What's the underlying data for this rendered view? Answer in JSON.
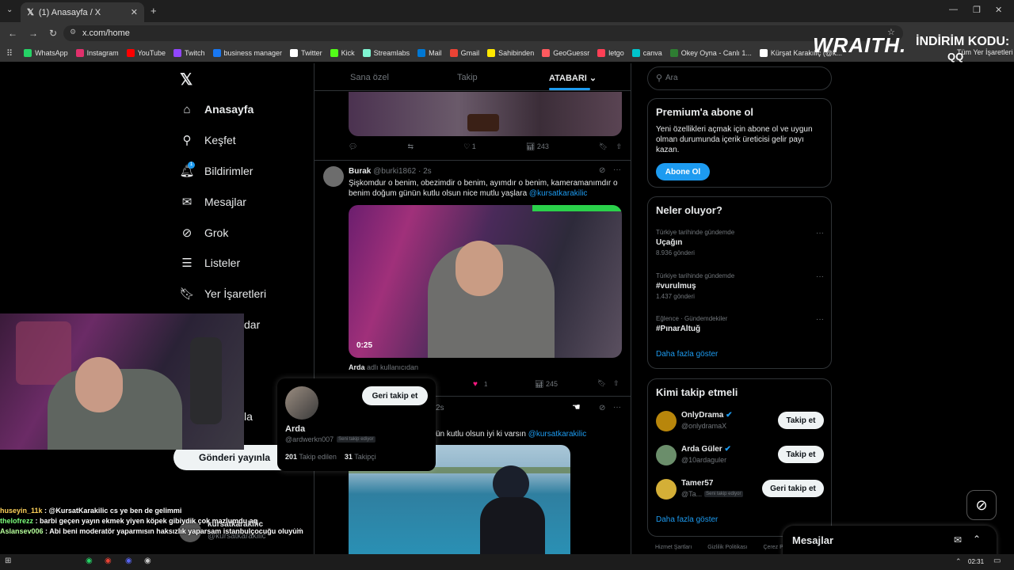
{
  "browser": {
    "tab_title": "(1) Anasayfa / X",
    "url": "x.com/home",
    "bookmarks": [
      {
        "label": "WhatsApp",
        "color": "#25d366"
      },
      {
        "label": "Instagram",
        "color": "#e1306c"
      },
      {
        "label": "YouTube",
        "color": "#ff0000"
      },
      {
        "label": "Twitch",
        "color": "#9146ff"
      },
      {
        "label": "business manager",
        "color": "#1877f2"
      },
      {
        "label": "Twitter",
        "color": "#ffffff"
      },
      {
        "label": "Kick",
        "color": "#53fc18"
      },
      {
        "label": "Streamlabs",
        "color": "#80f5d2"
      },
      {
        "label": "Mail",
        "color": "#0078d4"
      },
      {
        "label": "Gmail",
        "color": "#ea4335"
      },
      {
        "label": "Sahibinden",
        "color": "#ffe800"
      },
      {
        "label": "GeoGuessr",
        "color": "#ff5a5f"
      },
      {
        "label": "letgo",
        "color": "#ff3f55"
      },
      {
        "label": "canva",
        "color": "#00c4cc"
      },
      {
        "label": "Okey Oyna - Canlı 1...",
        "color": "#2e7d32"
      },
      {
        "label": "Kürşat Karakılıç (@k...",
        "color": "#ffffff"
      }
    ],
    "bookmarks_right": "Tüm Yer İşaretleri"
  },
  "overlay_brand": {
    "logo": "WRAITH.",
    "promo": "İNDİRİM KODU:",
    "code": "QQ"
  },
  "nav": {
    "items": [
      {
        "label": "Anasayfa",
        "icon": "home-icon",
        "glyph": "⌂"
      },
      {
        "label": "Keşfet",
        "icon": "search-icon",
        "glyph": "⚲"
      },
      {
        "label": "Bildirimler",
        "icon": "bell-icon",
        "glyph": "🔔︎"
      },
      {
        "label": "Mesajlar",
        "icon": "mail-icon",
        "glyph": "✉"
      },
      {
        "label": "Grok",
        "icon": "grok-icon",
        "glyph": "⊘"
      },
      {
        "label": "Listeler",
        "icon": "list-icon",
        "glyph": "☰"
      },
      {
        "label": "Yer İşaretleri",
        "icon": "bookmark-icon",
        "glyph": "🔖︎"
      }
    ],
    "partial_labels": [
      "dar",
      "la"
    ],
    "notification_badge": "1",
    "post_button": "Gönderi yayınla",
    "account_handle": "@kursatkarakilic",
    "account_name": "kursatkarakilic"
  },
  "feed": {
    "tabs": [
      "Sana özel",
      "Takip",
      "ATABARI"
    ],
    "tweet1": {
      "likes": "1",
      "views": "243"
    },
    "tweet2": {
      "name": "Burak",
      "handle": "@burki1862 · 2s",
      "text": "Şişkomdur o benim, obezimdir o benim, ayımdır o benim, kameramanımdır o benim doğum günün kutlu olsun nice mutlu yaşlara ",
      "mention": "@kursatkarakilic",
      "video_time": "0:25",
      "reply_user": "Arda",
      "reply_note": " adlı kullanıcıdan",
      "likes": "1",
      "views": "245"
    },
    "tweet3": {
      "time": "2s",
      "text": "ün kutlu olsun iyi ki varsın ",
      "mention": "@kursatkarakilic"
    }
  },
  "popup": {
    "name": "Arda",
    "handle": "@ardwerkn007",
    "badge": "Seni takip ediyor",
    "button": "Geri takip et",
    "following_count": "201",
    "following_label": "Takip edilen",
    "followers_count": "31",
    "followers_label": "Takipçi"
  },
  "right": {
    "search_placeholder": "Ara",
    "premium": {
      "title": "Premium'a abone ol",
      "text": "Yeni özellikleri açmak için abone ol ve uygun olman durumunda içerik üreticisi gelir payı kazan.",
      "button": "Abone Ol"
    },
    "trends": {
      "title": "Neler oluyor?",
      "items": [
        {
          "context": "Türkiye tarihinde gündemde",
          "name": "Uçağın",
          "count": "8.936 gönderi"
        },
        {
          "context": "Türkiye tarihinde gündemde",
          "name": "#vurulmuş",
          "count": "1.437 gönderi"
        },
        {
          "context": "Eğlence · Gündemdekiler",
          "name": "#PınarAltuğ",
          "count": ""
        }
      ],
      "more": "Daha fazla göster"
    },
    "follow": {
      "title": "Kimi takip etmeli",
      "items": [
        {
          "name": "OnlyDrama",
          "handle": "@onlydramaX",
          "button": "Takip et",
          "badge": ""
        },
        {
          "name": "Arda Güler",
          "handle": "@10ardaguler",
          "button": "Takip et",
          "badge": ""
        },
        {
          "name": "Tamer57",
          "handle": "@Ta...",
          "button": "Geri takip et",
          "badge": "Seni takip ediyor"
        }
      ],
      "more": "Daha fazla göster"
    },
    "footer": [
      "Hizmet Şartları",
      "Gizlilik Politikası",
      "Çerez Po"
    ],
    "messages": "Mesajlar"
  },
  "chat": [
    {
      "user": "huseyin_11k",
      "color": "#ffd35a",
      "text": " : @KursatKarakilic cs ye ben de gelimmi"
    },
    {
      "user": "thelofrezz",
      "color": "#7cff7c",
      "text": " : barbi geçen yayın ekmek yiyen köpek gibiydik çok mazlumdu aq"
    },
    {
      "user": "Aslansev006",
      "color": "#b6ff9b",
      "text": " : Abi beni moderatör yaparmısın haksızlık yaparsam istanbulçocuğu oluyum"
    }
  ],
  "taskbar": {
    "time": "02:31"
  }
}
